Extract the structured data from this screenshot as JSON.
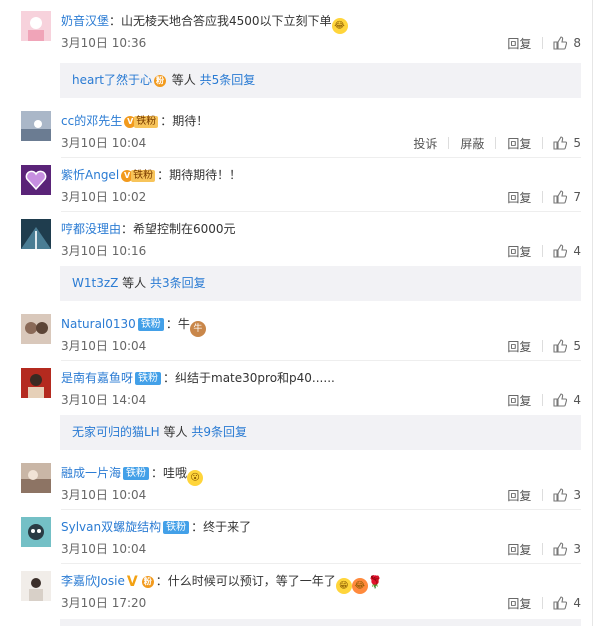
{
  "comments": [
    {
      "name": "奶音汉堡",
      "text": "：山无棱天地合答应我4500以下立刻下单",
      "time": "3月10日 10:36",
      "reply": "回复",
      "likes": "8",
      "avatar_color": "#f5c7d2"
    },
    {
      "name": "cc的邓先生",
      "text": "：期待！",
      "time": "3月10日 10:04",
      "report": "投诉",
      "block": "屏蔽",
      "reply": "回复",
      "likes": "5",
      "badge": "铁粉",
      "avatar_color": "#7d93aa"
    },
    {
      "name": "紫忻Angel",
      "text": "：期待期待！！",
      "time": "3月10日 10:02",
      "reply": "回复",
      "likes": "7",
      "badge": "铁粉",
      "avatar_color": "#6b2b8c"
    },
    {
      "name": "哼都没理由",
      "text": "：希望控制在6000元",
      "time": "3月10日 10:16",
      "reply": "回复",
      "likes": "4",
      "avatar_color": "#2f5a6e"
    },
    {
      "name": "Natural0130",
      "text": "：牛",
      "time": "3月10日 10:04",
      "reply": "回复",
      "likes": "5",
      "badge": "铁粉",
      "avatar_color": "#b08a78"
    },
    {
      "name": "是南有嘉鱼呀",
      "text": "：纠结于mate30pro和p40......",
      "time": "3月10日 14:04",
      "reply": "回复",
      "likes": "4",
      "badge": "铁粉",
      "avatar_color": "#b42a1f"
    },
    {
      "name": "融成一片海",
      "text": "：哇哦",
      "time": "3月10日 10:04",
      "reply": "回复",
      "likes": "3",
      "badge": "铁粉",
      "avatar_color": "#a08a7a"
    },
    {
      "name": "Sylvan双螺旋结构",
      "text": "：终于来了",
      "time": "3月10日 10:04",
      "reply": "回复",
      "likes": "3",
      "badge": "铁粉",
      "avatar_color": "#5ba7b0"
    },
    {
      "name": "李嘉欣Josie",
      "text": "：什么时候可以预订，等了一年了",
      "time": "3月10日 17:20",
      "reply": "回复",
      "likes": "4",
      "avatar_color": "#e8e0d8"
    }
  ],
  "reply_bars": [
    {
      "user": "heart了然于心",
      "mid": " 等人 ",
      "count": "共5条回复"
    },
    {
      "user": "W1t3zZ",
      "mid": " 等人 ",
      "count": "共3条回复"
    },
    {
      "user": "无家可归的猫LH",
      "mid": " 等人 ",
      "count": "共9条回复"
    }
  ],
  "gold_badge": "铁粉",
  "colors": {
    "link": "#2a7bd3",
    "fan_badge": "#43a0e8",
    "reply_bg": "#f2f2f5"
  }
}
